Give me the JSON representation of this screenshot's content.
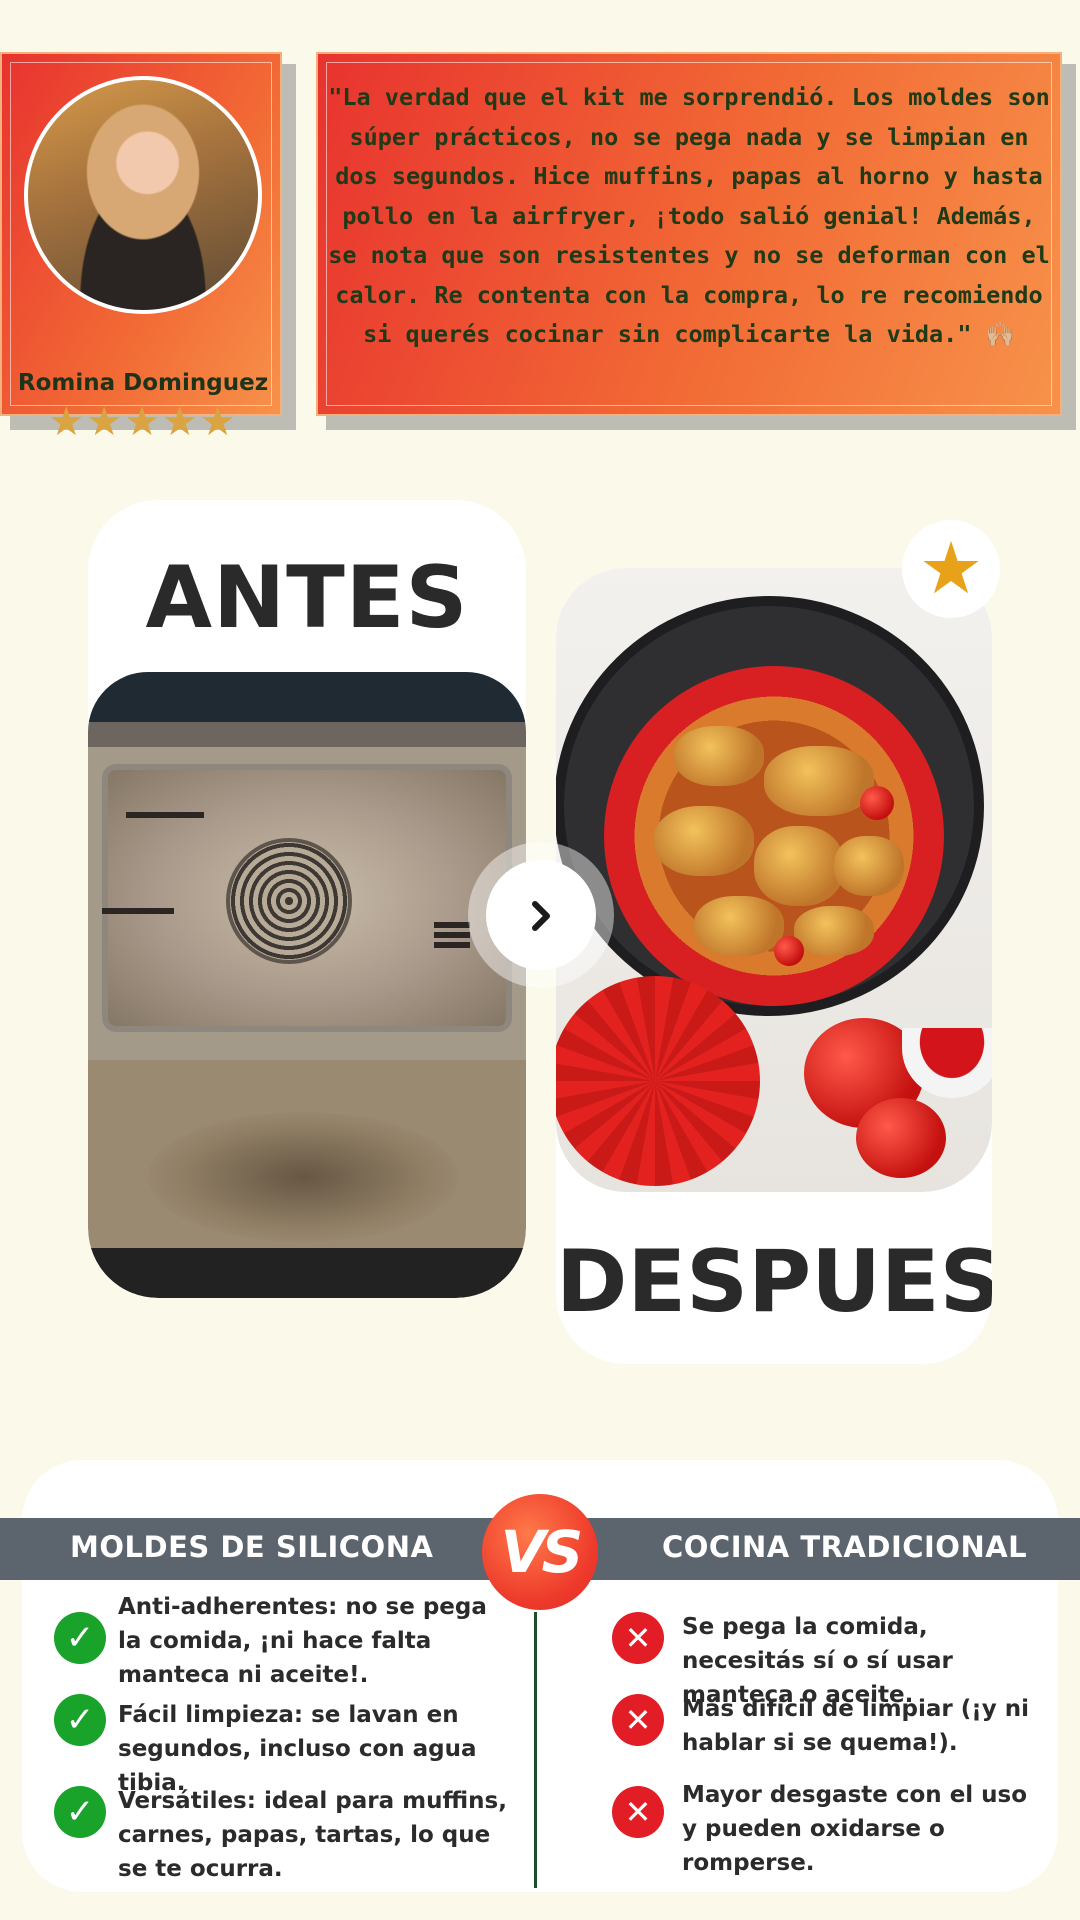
{
  "testimonial": {
    "reviewer_name": "Romina Dominguez",
    "rating": 5,
    "stars": "★★★★★",
    "quote": "\"La verdad que el kit me sorprendió. Los moldes son súper prácticos, no se pega nada y se limpian en dos segundos. Hice muffins, papas al horno y hasta pollo en la airfryer, ¡todo salió genial! Además, se nota que son resistentes y no se deforman con el calor. Re contenta con la compra, lo re recomiendo si querés cocinar sin complicarte la vida.\" 🙌🏼"
  },
  "before_after": {
    "before_title": "ANTES",
    "after_title": "DESPUES",
    "badge_icon": "star-icon",
    "next_icon": "chevron-right-icon"
  },
  "comparison": {
    "left_heading": "MOLDES DE SILICONA",
    "right_heading": "COCINA TRADICIONAL",
    "vs_label": "VS",
    "pros": [
      {
        "text": "Anti-adherentes: no se pega la comida, ¡ni hace falta manteca ni aceite!."
      },
      {
        "text": "Fácil limpieza: se lavan en segundos, incluso con agua tibia."
      },
      {
        "text": "Versátiles: ideal para muffins, carnes, papas, tartas, lo que se te ocurra."
      }
    ],
    "cons": [
      {
        "text": "Se pega la comida, necesitás sí o sí usar manteca o aceite."
      },
      {
        "text": "Más difícil de limpiar (¡y ni hablar si se quema!)."
      },
      {
        "text": "Mayor desgaste con el uso y pueden oxidarse o romperse."
      }
    ]
  },
  "colors": {
    "background": "#fbf9e9",
    "card_gradient_start": "#e8332f",
    "card_gradient_end": "#f7924a",
    "quote_text": "#1f3a17",
    "heading_bar": "#5c656d",
    "check": "#1aa32a",
    "cross": "#e21d26"
  }
}
